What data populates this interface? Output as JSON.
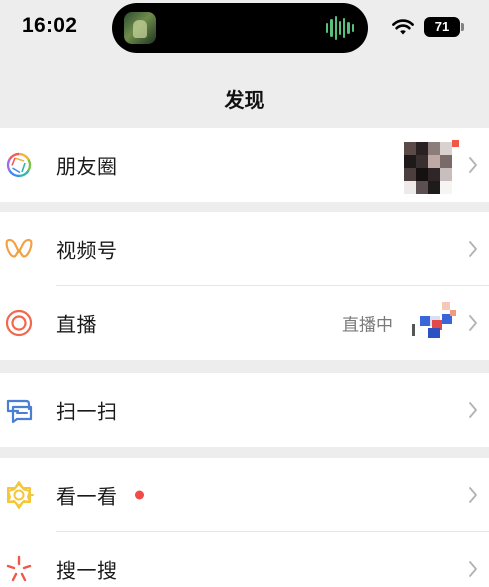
{
  "status_bar": {
    "time": "16:02",
    "battery": "71"
  },
  "nav": {
    "title": "发现"
  },
  "menu": {
    "moments": {
      "label": "朋友圈",
      "icon": "moments-aperture-icon"
    },
    "channels": {
      "label": "视频号",
      "icon": "channels-butterfly-icon"
    },
    "live": {
      "label": "直播",
      "status": "直播中",
      "icon": "live-ring-icon"
    },
    "scan": {
      "label": "扫一扫",
      "icon": "scan-icon"
    },
    "top_stories": {
      "label": "看一看",
      "icon": "top-stories-icon",
      "has_new": true
    },
    "search": {
      "label": "搜一搜",
      "icon": "search-sparkle-icon"
    }
  },
  "colors": {
    "background": "#ededed",
    "cell": "#ffffff",
    "badge_red": "#f04a4a",
    "channels_orange": "#f0a245",
    "live_red": "#f0684d",
    "scan_blue": "#4a7fd6",
    "top_stories_yellow": "#f4c63a",
    "search_red": "#f0584a"
  }
}
